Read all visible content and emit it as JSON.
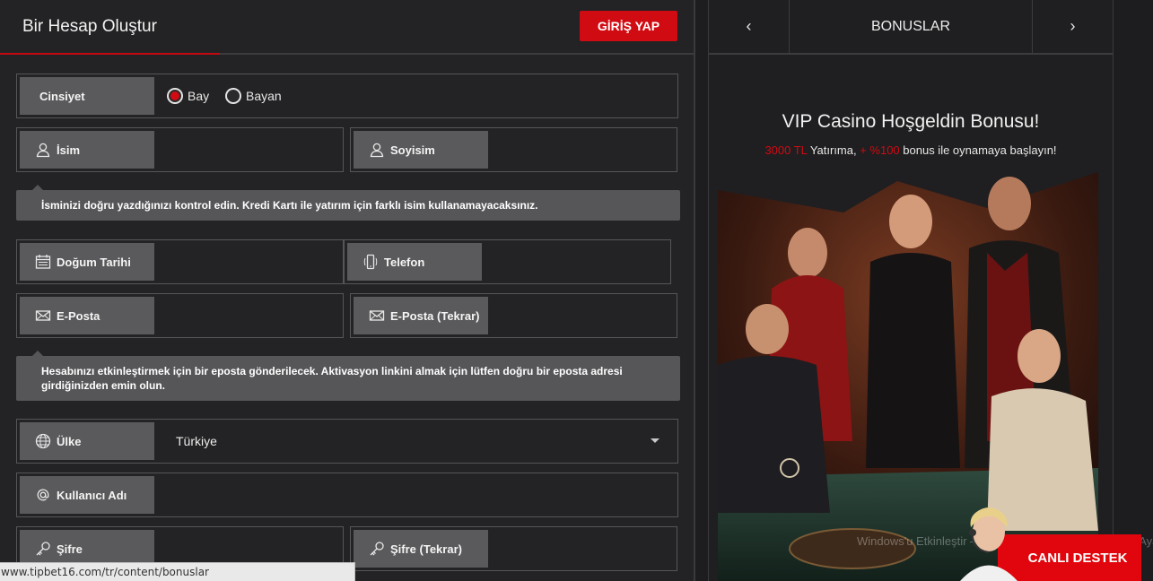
{
  "header": {
    "title": "Bir Hesap Oluştur",
    "login_label": "GİRİŞ YAP"
  },
  "form": {
    "gender": {
      "label": "Cinsiyet",
      "options": [
        "Bay",
        "Bayan"
      ],
      "selected": "Bay"
    },
    "first_name": {
      "label": "İsim",
      "icon": "user-icon"
    },
    "last_name": {
      "label": "Soyisim",
      "icon": "user-icon"
    },
    "name_hint": "İsminizi doğru yazdığınızı kontrol edin. Kredi Kartı ile yatırım için farklı isim kullanamayacaksınız.",
    "birth_date": {
      "label": "Doğum Tarihi",
      "icon": "calendar-icon"
    },
    "phone": {
      "label": "Telefon",
      "icon": "phone-icon"
    },
    "email": {
      "label": "E-Posta",
      "icon": "envelope-icon"
    },
    "email_repeat": {
      "label": "E-Posta (Tekrar)",
      "icon": "envelope-icon"
    },
    "email_hint": "Hesabınızı etkinleştirmek için bir eposta gönderilecek. Aktivasyon linkini almak için lütfen doğru bir eposta adresi girdiğinizden emin olun.",
    "country": {
      "label": "Ülke",
      "icon": "globe-icon",
      "value": "Türkiye"
    },
    "username": {
      "label": "Kullanıcı Adı",
      "icon": "at-icon"
    },
    "password": {
      "label": "Şifre",
      "icon": "key-icon"
    },
    "password_repeat": {
      "label": "Şifre (Tekrar)",
      "icon": "key-icon"
    }
  },
  "status_bar": {
    "url": "www.tipbet16.com/tr/content/bonuslar"
  },
  "bonus_panel": {
    "section_title": "BONUSLAR",
    "prev_label": "‹",
    "next_label": "›",
    "promo_title": "VIP Casino Hoşgeldin Bonusu!",
    "promo_amount": "3000 TL",
    "promo_text1": " Yatırıma, ",
    "promo_bonus": "+ %100",
    "promo_text2": " bonus ile oynamaya başlayın!"
  },
  "watermark": {
    "text": "Windows'u Etkinleştir — Windows'u etkinleştirmek için Ayarlar'a gidin."
  },
  "chat": {
    "label": "CANLI DESTEK"
  },
  "colors": {
    "accent": "#d10b12",
    "panel": "#232224",
    "label_bg": "#5a595b"
  }
}
